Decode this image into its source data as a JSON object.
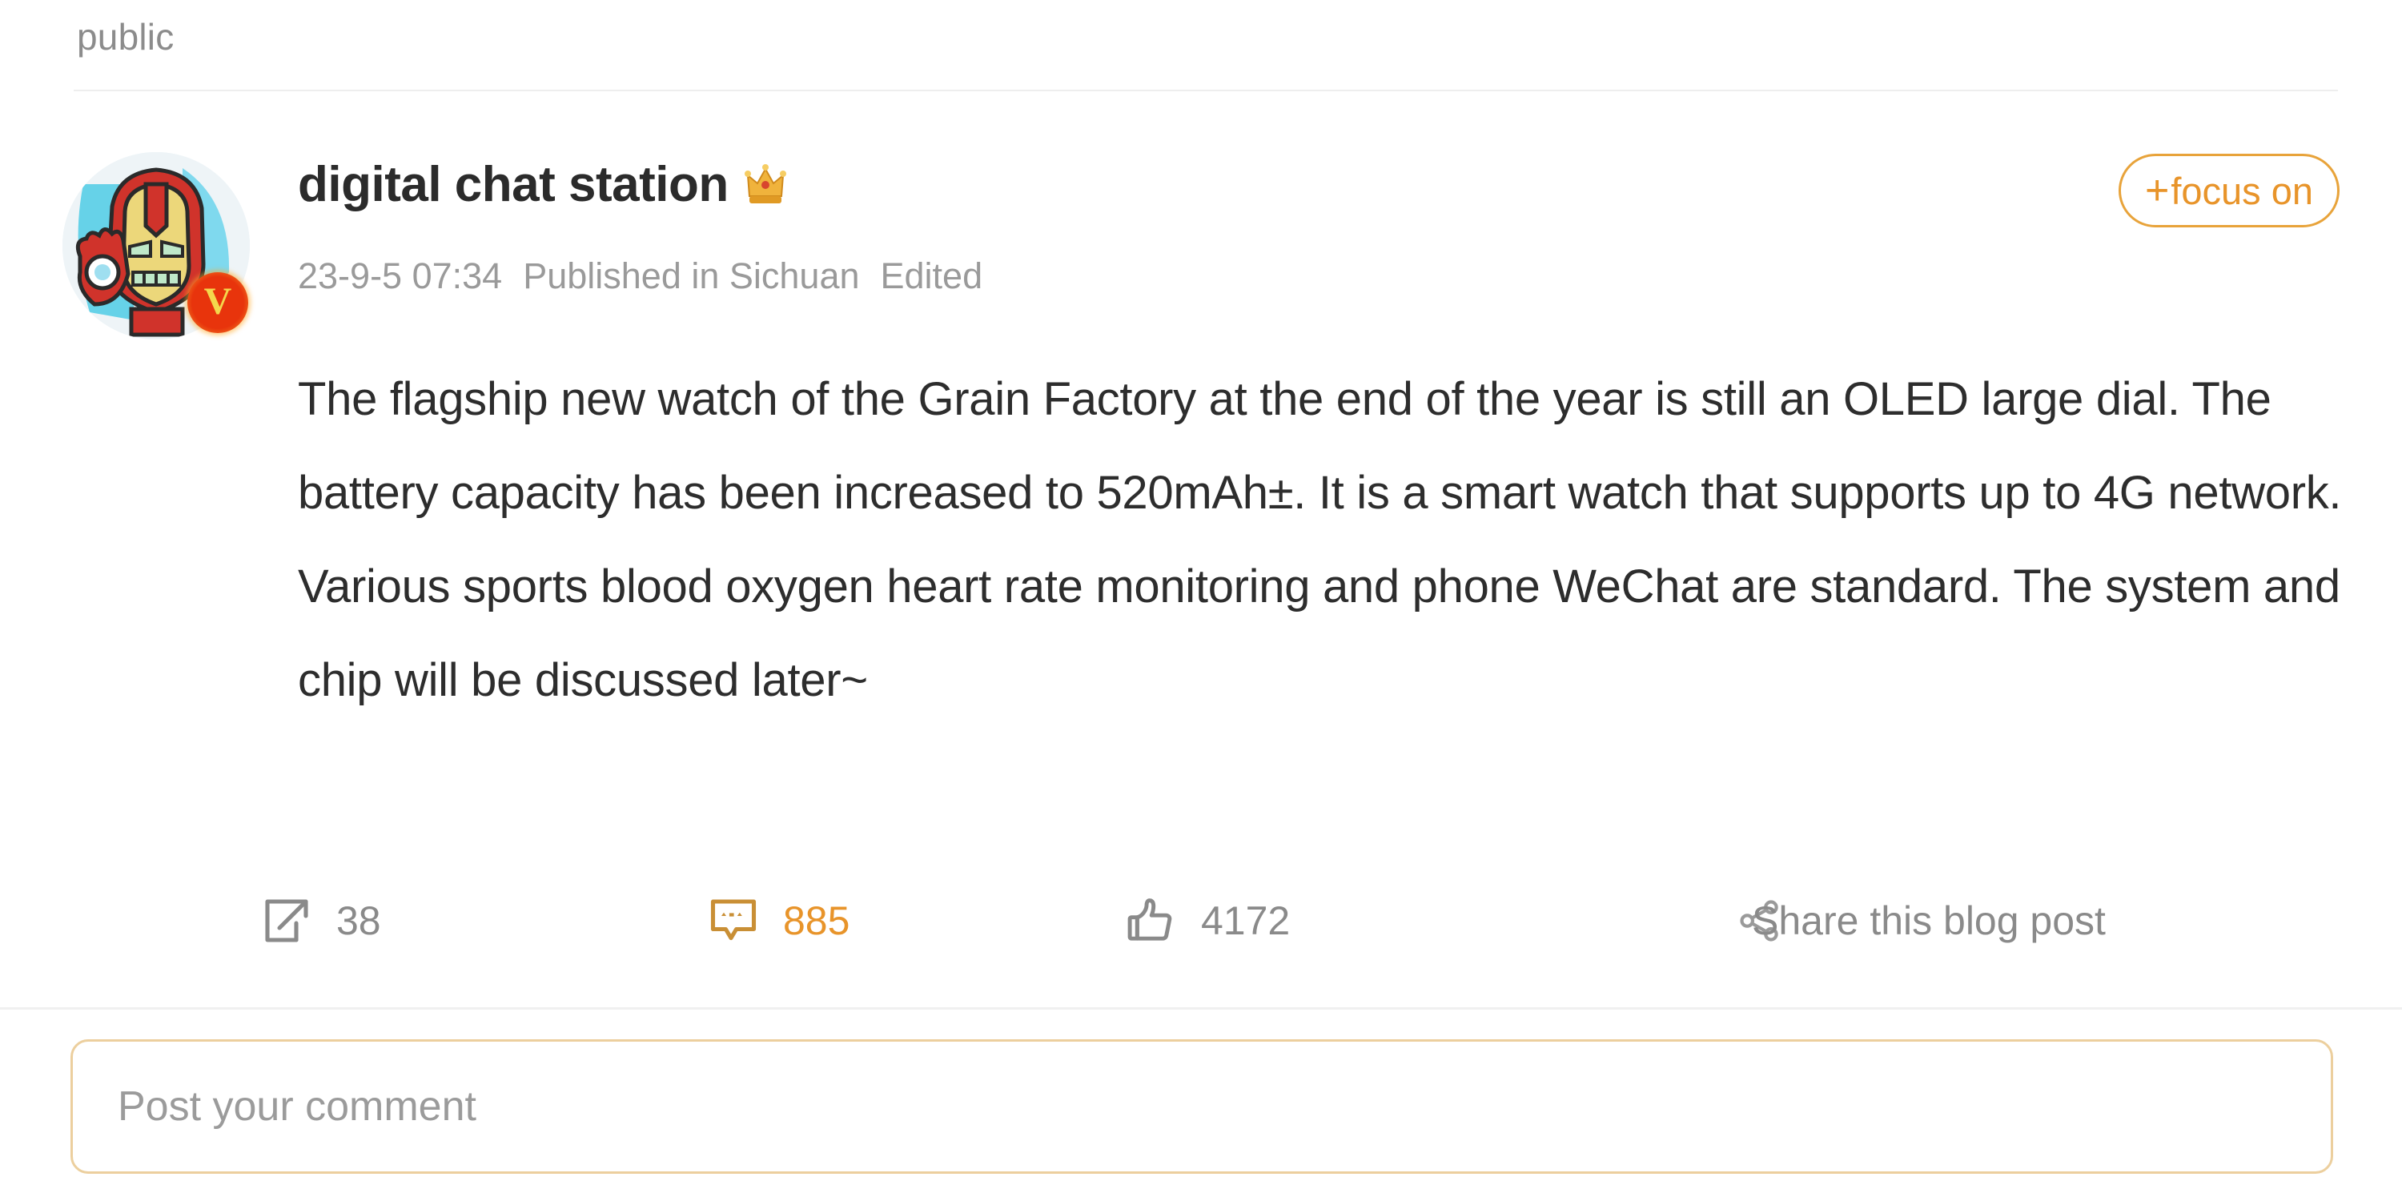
{
  "visibility": {
    "label": "public"
  },
  "post": {
    "author": {
      "name": "digital chat station",
      "badge_emoji": "crown-emoji",
      "verified_letter": "V",
      "avatar_alt": "iron-man-avatar"
    },
    "meta": {
      "timestamp": "23-9-5 07:34",
      "location": "Published in Sichuan",
      "edited": "Edited"
    },
    "follow_button": {
      "plus": "+",
      "label": "focus on"
    },
    "content": "The flagship new watch of the Grain Factory at the end of the year is still an OLED large dial. The battery capacity has been increased to 520mAh±. It is a smart watch that supports up to 4G network. Various sports blood oxygen heart rate monitoring and phone WeChat are standard. The system and chip will be discussed later~"
  },
  "actions": {
    "share": {
      "icon": "external-link-icon",
      "count": "38"
    },
    "comment": {
      "icon": "comment-bubble-icon",
      "count": "885"
    },
    "like": {
      "icon": "thumbs-up-icon",
      "count": "4172"
    },
    "blog_share": {
      "icon": "share-nodes-icon",
      "label": "Share this blog post"
    }
  },
  "comment_input": {
    "placeholder": "Post your comment",
    "value": ""
  },
  "colors": {
    "accent_orange": "#e8942a",
    "border_orange": "#eccf9e",
    "text_primary": "#2d2d2d",
    "text_muted": "#9a9a9a",
    "verify_red": "#e8340c"
  }
}
